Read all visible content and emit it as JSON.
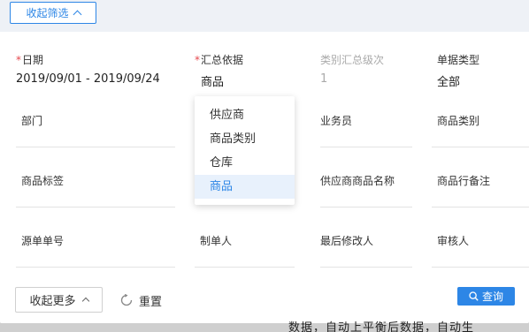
{
  "toggle": {
    "collapse_filter_label": "收起筛选"
  },
  "fields": {
    "date": {
      "label": "日期",
      "value": "2019/09/01 - 2019/09/24"
    },
    "summary_basis": {
      "label": "汇总依据",
      "value": "商品"
    },
    "category_level": {
      "label": "类别汇总级次",
      "value": "1"
    },
    "doc_type": {
      "label": "单据类型",
      "value": "全部"
    },
    "department": {
      "label": "部门"
    },
    "salesperson": {
      "label": "业务员"
    },
    "product_category": {
      "label": "商品类别"
    },
    "product_tag": {
      "label": "商品标签"
    },
    "supplier_product_name": {
      "label": "供应商商品名称"
    },
    "product_line_remark": {
      "label": "商品行备注"
    },
    "source_doc_no": {
      "label": "源单单号"
    },
    "creator": {
      "label": "制单人"
    },
    "last_modifier": {
      "label": "最后修改人"
    },
    "reviewer": {
      "label": "审核人"
    }
  },
  "dropdown": {
    "options": [
      "供应商",
      "商品类别",
      "仓库",
      "商品"
    ],
    "selected": "商品"
  },
  "footer": {
    "more_label": "收起更多",
    "reset_label": "重置",
    "query_label": "查询"
  },
  "background_text": "数据，自动上平衡后数据，自动生"
}
